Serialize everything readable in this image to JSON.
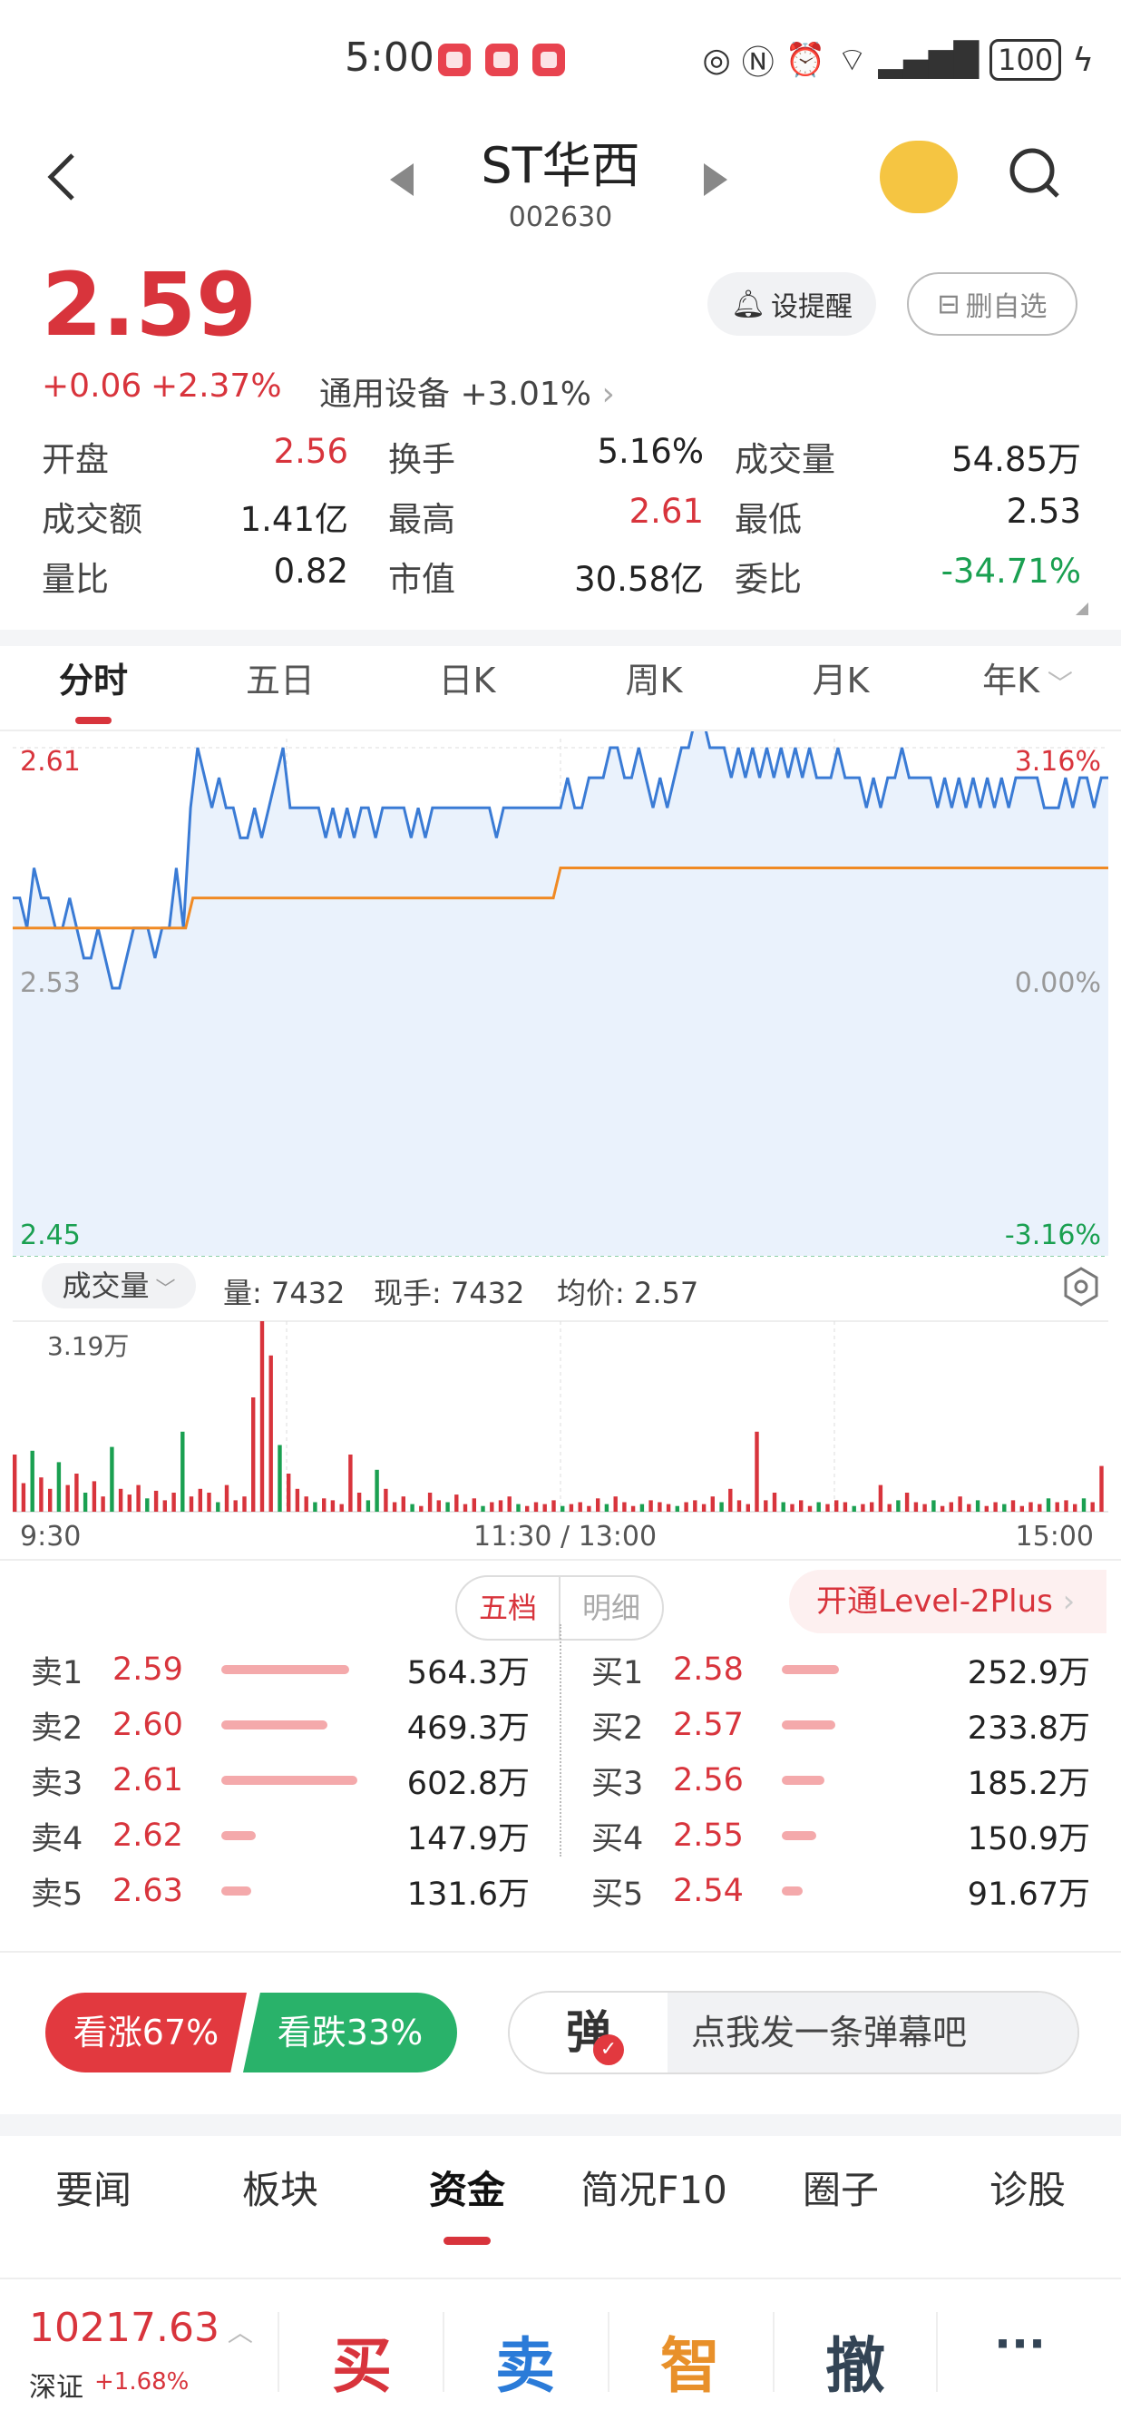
{
  "status_bar": {
    "time": "5:00",
    "battery": "100"
  },
  "header": {
    "title": "ST华西",
    "code": "002630"
  },
  "quote": {
    "price": "2.59",
    "change": "+0.06",
    "change_pct": "+2.37%",
    "sector": "通用设备 +3.01%",
    "remind_label": "设提醒",
    "watch_label": "删自选",
    "fields": [
      {
        "label": "开盘",
        "value": "2.56",
        "color": "red"
      },
      {
        "label": "换手",
        "value": "5.16%",
        "color": "black"
      },
      {
        "label": "成交量",
        "value": "54.85万",
        "color": "black"
      },
      {
        "label": "成交额",
        "value": "1.41亿",
        "color": "black"
      },
      {
        "label": "最高",
        "value": "2.61",
        "color": "red"
      },
      {
        "label": "最低",
        "value": "2.53",
        "color": "black"
      },
      {
        "label": "量比",
        "value": "0.82",
        "color": "black"
      },
      {
        "label": "市值",
        "value": "30.58亿",
        "color": "black"
      },
      {
        "label": "委比",
        "value": "-34.71%",
        "color": "green"
      }
    ]
  },
  "chart_tabs": [
    "分时",
    "五日",
    "日K",
    "周K",
    "月K",
    "年K"
  ],
  "chart_data": {
    "type": "line",
    "y_left_labels": {
      "top": "2.61",
      "mid": "2.53",
      "bottom": "2.45"
    },
    "y_right_labels": {
      "top": "3.16%",
      "mid": "0.00%",
      "bottom": "-3.16%"
    },
    "ylim": [
      2.45,
      2.61
    ],
    "series": [
      {
        "values": [
          2.56,
          2.56,
          2.55,
          2.57,
          2.56,
          2.56,
          2.55,
          2.55,
          2.56,
          2.55,
          2.54,
          2.54,
          2.55,
          2.54,
          2.53,
          2.53,
          2.54,
          2.55,
          2.55,
          2.55,
          2.54,
          2.55,
          2.55,
          2.57,
          2.55,
          2.59,
          2.61,
          2.6,
          2.59,
          2.6,
          2.59,
          2.59,
          2.58,
          2.58,
          2.59,
          2.58,
          2.59,
          2.6,
          2.61,
          2.59,
          2.59,
          2.59,
          2.59,
          2.59,
          2.58,
          2.59,
          2.58,
          2.59,
          2.58,
          2.59,
          2.59,
          2.58,
          2.59,
          2.59,
          2.59,
          2.59,
          2.58,
          2.59,
          2.58,
          2.59,
          2.59,
          2.59,
          2.59,
          2.59,
          2.59,
          2.59,
          2.59,
          2.59,
          2.58,
          2.59,
          2.59,
          2.59,
          2.59,
          2.59,
          2.59,
          2.59,
          2.59,
          2.59,
          2.6,
          2.59,
          2.59,
          2.6,
          2.6,
          2.6,
          2.61,
          2.61,
          2.6,
          2.6,
          2.61,
          2.6,
          2.59,
          2.6,
          2.59,
          2.6,
          2.61,
          2.61,
          2.62,
          2.62,
          2.61,
          2.61,
          2.61,
          2.6,
          2.61,
          2.6,
          2.61,
          2.6,
          2.61,
          2.6,
          2.61,
          2.6,
          2.61,
          2.6,
          2.61,
          2.6,
          2.6,
          2.6,
          2.61,
          2.6,
          2.6,
          2.6,
          2.59,
          2.6,
          2.59,
          2.6,
          2.6,
          2.61,
          2.6,
          2.6,
          2.6,
          2.6,
          2.59,
          2.6,
          2.59,
          2.6,
          2.59,
          2.6,
          2.59,
          2.6,
          2.59,
          2.6,
          2.59,
          2.6,
          2.6,
          2.6,
          2.6,
          2.59,
          2.59,
          2.59,
          2.6,
          2.59,
          2.6,
          2.6,
          2.59,
          2.6,
          2.6
        ]
      },
      {
        "values": [
          2.55,
          2.55,
          2.55,
          2.55,
          2.55,
          2.55,
          2.55,
          2.55,
          2.55,
          2.55,
          2.55,
          2.55,
          2.55,
          2.55,
          2.55,
          2.55,
          2.55,
          2.55,
          2.55,
          2.55,
          2.55,
          2.55,
          2.55,
          2.55,
          2.55,
          2.56,
          2.56,
          2.56,
          2.56,
          2.56,
          2.56,
          2.56,
          2.56,
          2.56,
          2.56,
          2.56,
          2.56,
          2.56,
          2.56,
          2.56,
          2.56,
          2.56,
          2.56,
          2.56,
          2.56,
          2.56,
          2.56,
          2.56,
          2.56,
          2.56,
          2.56,
          2.56,
          2.56,
          2.56,
          2.56,
          2.56,
          2.56,
          2.56,
          2.56,
          2.56,
          2.56,
          2.56,
          2.56,
          2.56,
          2.56,
          2.56,
          2.56,
          2.56,
          2.56,
          2.56,
          2.56,
          2.56,
          2.56,
          2.56,
          2.56,
          2.56,
          2.57,
          2.57,
          2.57,
          2.57,
          2.57,
          2.57,
          2.57,
          2.57,
          2.57,
          2.57,
          2.57,
          2.57,
          2.57,
          2.57,
          2.57,
          2.57,
          2.57,
          2.57,
          2.57,
          2.57,
          2.57,
          2.57,
          2.57,
          2.57,
          2.57,
          2.57,
          2.57,
          2.57,
          2.57,
          2.57,
          2.57,
          2.57,
          2.57,
          2.57,
          2.57,
          2.57,
          2.57,
          2.57,
          2.57,
          2.57,
          2.57,
          2.57,
          2.57,
          2.57,
          2.57,
          2.57,
          2.57,
          2.57,
          2.57,
          2.57,
          2.57,
          2.57,
          2.57,
          2.57,
          2.57,
          2.57,
          2.57,
          2.57,
          2.57,
          2.57,
          2.57,
          2.57,
          2.57,
          2.57,
          2.57,
          2.57,
          2.57,
          2.57,
          2.57,
          2.57,
          2.57,
          2.57,
          2.57,
          2.57,
          2.57,
          2.57,
          2.57
        ]
      }
    ],
    "price_color": "#3a7bd5",
    "avg_color": "#f08a24"
  },
  "volume": {
    "selector": "成交量",
    "qty_label": "量: 7432",
    "cur_label": "现手: 7432",
    "avg_label": "均价: 2.57",
    "max_label": "3.19万",
    "bars": [
      {
        "v": 0.3,
        "c": "r"
      },
      {
        "v": 0.15,
        "c": "r"
      },
      {
        "v": 0.32,
        "c": "g"
      },
      {
        "v": 0.18,
        "c": "r"
      },
      {
        "v": 0.12,
        "c": "r"
      },
      {
        "v": 0.26,
        "c": "g"
      },
      {
        "v": 0.14,
        "c": "r"
      },
      {
        "v": 0.2,
        "c": "r"
      },
      {
        "v": 0.1,
        "c": "g"
      },
      {
        "v": 0.16,
        "c": "r"
      },
      {
        "v": 0.08,
        "c": "r"
      },
      {
        "v": 0.34,
        "c": "g"
      },
      {
        "v": 0.12,
        "c": "r"
      },
      {
        "v": 0.09,
        "c": "r"
      },
      {
        "v": 0.14,
        "c": "r"
      },
      {
        "v": 0.07,
        "c": "g"
      },
      {
        "v": 0.11,
        "c": "r"
      },
      {
        "v": 0.06,
        "c": "r"
      },
      {
        "v": 0.1,
        "c": "r"
      },
      {
        "v": 0.42,
        "c": "g"
      },
      {
        "v": 0.08,
        "c": "r"
      },
      {
        "v": 0.12,
        "c": "r"
      },
      {
        "v": 0.1,
        "c": "r"
      },
      {
        "v": 0.05,
        "c": "g"
      },
      {
        "v": 0.14,
        "c": "r"
      },
      {
        "v": 0.06,
        "c": "r"
      },
      {
        "v": 0.08,
        "c": "r"
      },
      {
        "v": 0.6,
        "c": "r"
      },
      {
        "v": 1.0,
        "c": "r"
      },
      {
        "v": 0.82,
        "c": "r"
      },
      {
        "v": 0.35,
        "c": "g"
      },
      {
        "v": 0.2,
        "c": "r"
      },
      {
        "v": 0.12,
        "c": "r"
      },
      {
        "v": 0.08,
        "c": "r"
      },
      {
        "v": 0.05,
        "c": "g"
      },
      {
        "v": 0.07,
        "c": "r"
      },
      {
        "v": 0.06,
        "c": "r"
      },
      {
        "v": 0.04,
        "c": "r"
      },
      {
        "v": 0.3,
        "c": "r"
      },
      {
        "v": 0.1,
        "c": "r"
      },
      {
        "v": 0.06,
        "c": "g"
      },
      {
        "v": 0.22,
        "c": "g"
      },
      {
        "v": 0.12,
        "c": "r"
      },
      {
        "v": 0.05,
        "c": "r"
      },
      {
        "v": 0.08,
        "c": "r"
      },
      {
        "v": 0.04,
        "c": "g"
      },
      {
        "v": 0.03,
        "c": "r"
      },
      {
        "v": 0.1,
        "c": "r"
      },
      {
        "v": 0.06,
        "c": "r"
      },
      {
        "v": 0.05,
        "c": "g"
      },
      {
        "v": 0.09,
        "c": "r"
      },
      {
        "v": 0.04,
        "c": "r"
      },
      {
        "v": 0.07,
        "c": "r"
      },
      {
        "v": 0.03,
        "c": "g"
      },
      {
        "v": 0.05,
        "c": "r"
      },
      {
        "v": 0.06,
        "c": "r"
      },
      {
        "v": 0.08,
        "c": "r"
      },
      {
        "v": 0.04,
        "c": "g"
      },
      {
        "v": 0.03,
        "c": "r"
      },
      {
        "v": 0.05,
        "c": "r"
      },
      {
        "v": 0.04,
        "c": "r"
      },
      {
        "v": 0.06,
        "c": "r"
      },
      {
        "v": 0.03,
        "c": "g"
      },
      {
        "v": 0.04,
        "c": "r"
      },
      {
        "v": 0.05,
        "c": "r"
      },
      {
        "v": 0.03,
        "c": "r"
      },
      {
        "v": 0.07,
        "c": "r"
      },
      {
        "v": 0.04,
        "c": "g"
      },
      {
        "v": 0.08,
        "c": "r"
      },
      {
        "v": 0.05,
        "c": "r"
      },
      {
        "v": 0.03,
        "c": "r"
      },
      {
        "v": 0.04,
        "c": "g"
      },
      {
        "v": 0.06,
        "c": "r"
      },
      {
        "v": 0.05,
        "c": "r"
      },
      {
        "v": 0.04,
        "c": "r"
      },
      {
        "v": 0.03,
        "c": "g"
      },
      {
        "v": 0.05,
        "c": "r"
      },
      {
        "v": 0.06,
        "c": "r"
      },
      {
        "v": 0.04,
        "c": "r"
      },
      {
        "v": 0.08,
        "c": "r"
      },
      {
        "v": 0.05,
        "c": "g"
      },
      {
        "v": 0.12,
        "c": "r"
      },
      {
        "v": 0.06,
        "c": "r"
      },
      {
        "v": 0.04,
        "c": "r"
      },
      {
        "v": 0.42,
        "c": "r"
      },
      {
        "v": 0.06,
        "c": "r"
      },
      {
        "v": 0.1,
        "c": "r"
      },
      {
        "v": 0.05,
        "c": "g"
      },
      {
        "v": 0.04,
        "c": "r"
      },
      {
        "v": 0.06,
        "c": "r"
      },
      {
        "v": 0.03,
        "c": "r"
      },
      {
        "v": 0.05,
        "c": "g"
      },
      {
        "v": 0.04,
        "c": "r"
      },
      {
        "v": 0.06,
        "c": "r"
      },
      {
        "v": 0.05,
        "c": "r"
      },
      {
        "v": 0.03,
        "c": "g"
      },
      {
        "v": 0.04,
        "c": "r"
      },
      {
        "v": 0.05,
        "c": "r"
      },
      {
        "v": 0.14,
        "c": "r"
      },
      {
        "v": 0.04,
        "c": "r"
      },
      {
        "v": 0.06,
        "c": "g"
      },
      {
        "v": 0.1,
        "c": "r"
      },
      {
        "v": 0.05,
        "c": "r"
      },
      {
        "v": 0.04,
        "c": "r"
      },
      {
        "v": 0.06,
        "c": "g"
      },
      {
        "v": 0.03,
        "c": "r"
      },
      {
        "v": 0.05,
        "c": "r"
      },
      {
        "v": 0.08,
        "c": "r"
      },
      {
        "v": 0.04,
        "c": "r"
      },
      {
        "v": 0.06,
        "c": "g"
      },
      {
        "v": 0.03,
        "c": "r"
      },
      {
        "v": 0.05,
        "c": "r"
      },
      {
        "v": 0.04,
        "c": "g"
      },
      {
        "v": 0.06,
        "c": "r"
      },
      {
        "v": 0.03,
        "c": "r"
      },
      {
        "v": 0.05,
        "c": "r"
      },
      {
        "v": 0.04,
        "c": "r"
      },
      {
        "v": 0.07,
        "c": "g"
      },
      {
        "v": 0.05,
        "c": "r"
      },
      {
        "v": 0.06,
        "c": "r"
      },
      {
        "v": 0.04,
        "c": "r"
      },
      {
        "v": 0.07,
        "c": "g"
      },
      {
        "v": 0.05,
        "c": "r"
      },
      {
        "v": 0.24,
        "c": "r"
      }
    ]
  },
  "time_labels": {
    "start": "9:30",
    "mid": "11:30 / 13:00",
    "end": "15:00"
  },
  "orderbook": {
    "tab_five": "五档",
    "tab_detail": "明细",
    "level2": "开通Level-2Plus",
    "asks": [
      {
        "label": "卖1",
        "price": "2.59",
        "vol": "564.3万",
        "ratio": 0.94
      },
      {
        "label": "卖2",
        "price": "2.60",
        "vol": "469.3万",
        "ratio": 0.78
      },
      {
        "label": "卖3",
        "price": "2.61",
        "vol": "602.8万",
        "ratio": 1.0
      },
      {
        "label": "卖4",
        "price": "2.62",
        "vol": "147.9万",
        "ratio": 0.25
      },
      {
        "label": "卖5",
        "price": "2.63",
        "vol": "131.6万",
        "ratio": 0.22
      }
    ],
    "bids": [
      {
        "label": "买1",
        "price": "2.58",
        "vol": "252.9万",
        "ratio": 0.42
      },
      {
        "label": "买2",
        "price": "2.57",
        "vol": "233.8万",
        "ratio": 0.39
      },
      {
        "label": "买3",
        "price": "2.56",
        "vol": "185.2万",
        "ratio": 0.31
      },
      {
        "label": "买4",
        "price": "2.55",
        "vol": "150.9万",
        "ratio": 0.25
      },
      {
        "label": "买5",
        "price": "2.54",
        "vol": "91.67万",
        "ratio": 0.15
      }
    ]
  },
  "sentiment": {
    "up": "看涨67%",
    "down": "看跌33%",
    "danmu_icon": "弹",
    "danmu_placeholder": "点我发一条弹幕吧"
  },
  "bottom_tabs": [
    "要闻",
    "板块",
    "资金",
    "简况F10",
    "圈子",
    "诊股"
  ],
  "index": {
    "value": "10217.63",
    "name": "深证",
    "change": "+1.68%"
  },
  "actions": {
    "buy": "买",
    "sell": "卖",
    "smart": "智",
    "cancel": "撤",
    "more": "···"
  },
  "colors": {
    "up": "#d8343c",
    "down": "#1aa051",
    "buy": "#d8343c",
    "sell": "#2b7bd8",
    "smart": "#e8902a",
    "cancel": "#334455"
  }
}
